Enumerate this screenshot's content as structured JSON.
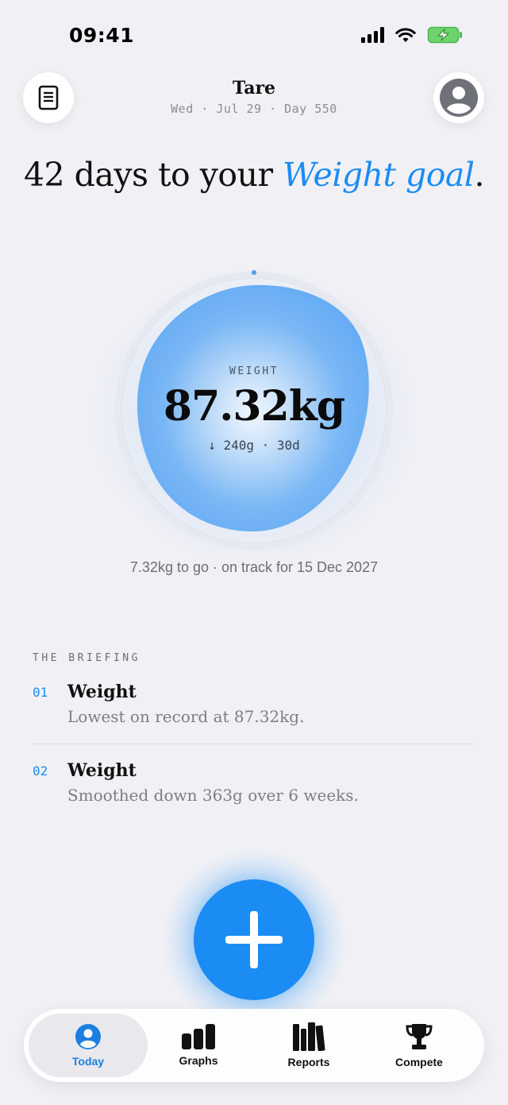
{
  "status": {
    "time": "09:41"
  },
  "header": {
    "title": "Tare",
    "date_line": "Wed · Jul 29 · Day 550",
    "left_icon": "notebook-icon",
    "right_icon": "profile-icon"
  },
  "headline": {
    "prefix": "42 days to your",
    "accent": "Weight goal",
    "suffix": "."
  },
  "gauge": {
    "label": "WEIGHT",
    "value": "87.32kg",
    "delta": "↓ 240g · 30d"
  },
  "goal_line": "7.32kg to go · on track for 15 Dec 2027",
  "briefing": {
    "label": "THE BRIEFING",
    "items": [
      {
        "num": "01",
        "title": "Weight",
        "text": "Lowest on record at 87.32kg."
      },
      {
        "num": "02",
        "title": "Weight",
        "text": "Smoothed down 363g over 6 weeks."
      }
    ]
  },
  "fab": {
    "icon": "plus-icon"
  },
  "tabs": [
    {
      "label": "Today",
      "icon": "person-icon",
      "active": true
    },
    {
      "label": "Graphs",
      "icon": "bar-chart-icon",
      "active": false
    },
    {
      "label": "Reports",
      "icon": "books-icon",
      "active": false
    },
    {
      "label": "Compete",
      "icon": "trophy-icon",
      "active": false
    }
  ],
  "colors": {
    "accent": "#1d8bf5",
    "blob": "#72b4f6",
    "background": "#f1f1f5"
  }
}
